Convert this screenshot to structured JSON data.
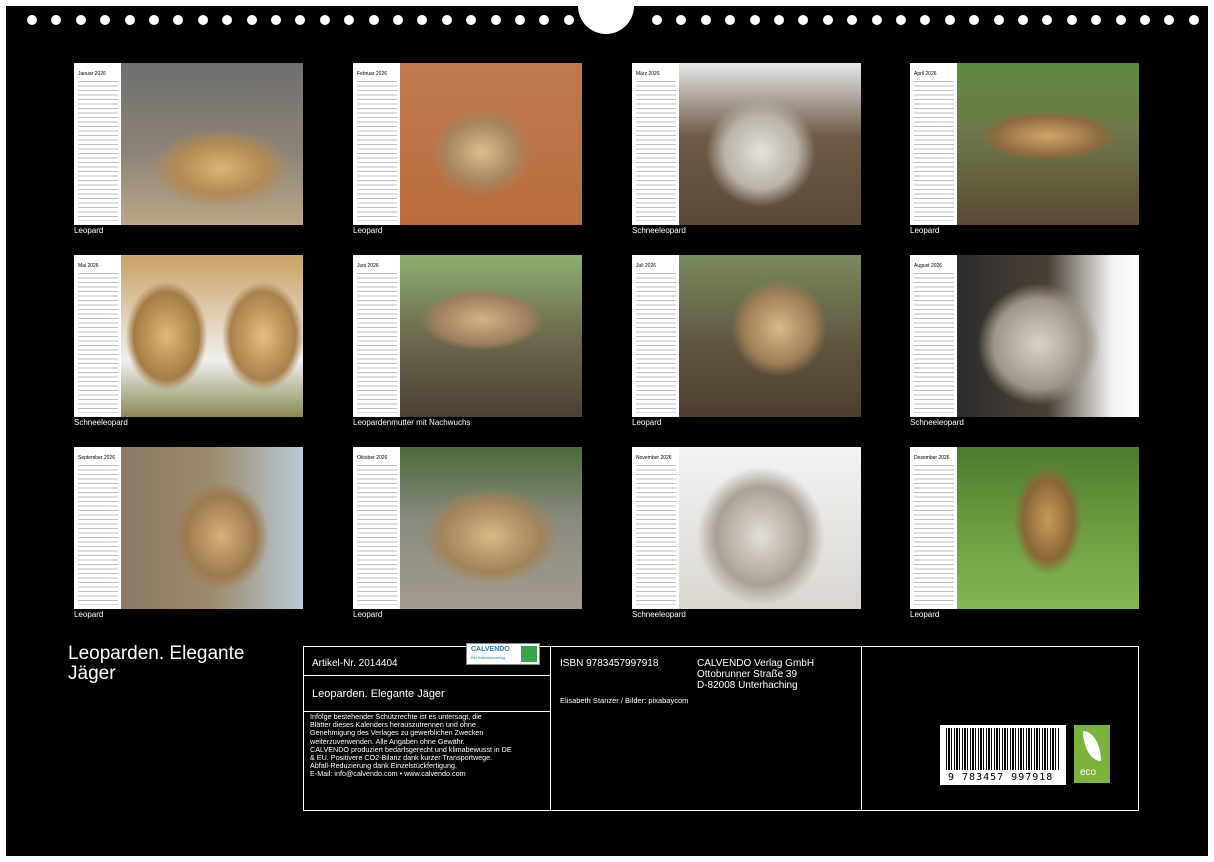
{
  "calendar_title": "Leoparden. Elegante Jäger",
  "year": "2026",
  "months": [
    {
      "month": "Januar",
      "caption": "Leopard",
      "photo": "leopard-lying"
    },
    {
      "month": "Februar",
      "caption": "Leopard",
      "photo": "leopard-walking"
    },
    {
      "month": "März",
      "caption": "Schneeleopard",
      "photo": "snow-leopard-snarl"
    },
    {
      "month": "April",
      "caption": "Leopard",
      "photo": "leopard-in-tree"
    },
    {
      "month": "Mai",
      "caption": "Schneeleopard",
      "photo": "snow-leopards-fight"
    },
    {
      "month": "Juni",
      "caption": "Leopardenmutter mit Nachwuchs",
      "photo": "mother-cub"
    },
    {
      "month": "Juli",
      "caption": "Leopard",
      "photo": "leopard-log"
    },
    {
      "month": "August",
      "caption": "Schneeleopard",
      "photo": "snow-leopard-roar"
    },
    {
      "month": "September",
      "caption": "Leopard",
      "photo": "leopard-tree-trunk"
    },
    {
      "month": "Oktober",
      "caption": "Leopard",
      "photo": "leopard-resting"
    },
    {
      "month": "November",
      "caption": "Schneeleopard",
      "photo": "snow-leopard-portrait"
    },
    {
      "month": "Dezember",
      "caption": "Leopard",
      "photo": "leopard-grass"
    }
  ],
  "back_info": {
    "article_no": "Artikel-Nr. 2014404",
    "logo_text": "CALVENDO",
    "logo_sub": "Bin Kalenderverlag",
    "title": "Leoparden. Elegante Jäger",
    "notice_lines": [
      "Infolge bestehender Schutzrechte ist es untersagt, die",
      "Blätter dieses Kalenders herauszutrennen und ohne",
      "Genehmigung des Verlages zu gewerblichen Zwecken",
      "weiterzuverwenden. Alle Angaben ohne Gewähr.",
      "CALVENDO produziert bedarfsgerecht und klimabewusst in DE",
      "& EU. Positivere CO2-Bilanz dank kurzer Transportwege.",
      "Abfall-Reduzierung dank Einzelstückfertigung.",
      "E-Mail: info@calvendo.com • www.calvendo.com"
    ],
    "isbn": "ISBN 9783457997918",
    "publisher": [
      "CALVENDO Verlag GmbH",
      "Ottobrunner Straße 39",
      "D-82008 Unterhaching"
    ],
    "credits": "Elisabeth Stanzer / Bilder: pixabaycom",
    "barcode_number": "9 783457 997918",
    "eco_label": "eco"
  },
  "colors": {
    "background": "#000000",
    "text": "#ffffff",
    "eco": "#7cb33c",
    "logo": "#2a7abf"
  }
}
